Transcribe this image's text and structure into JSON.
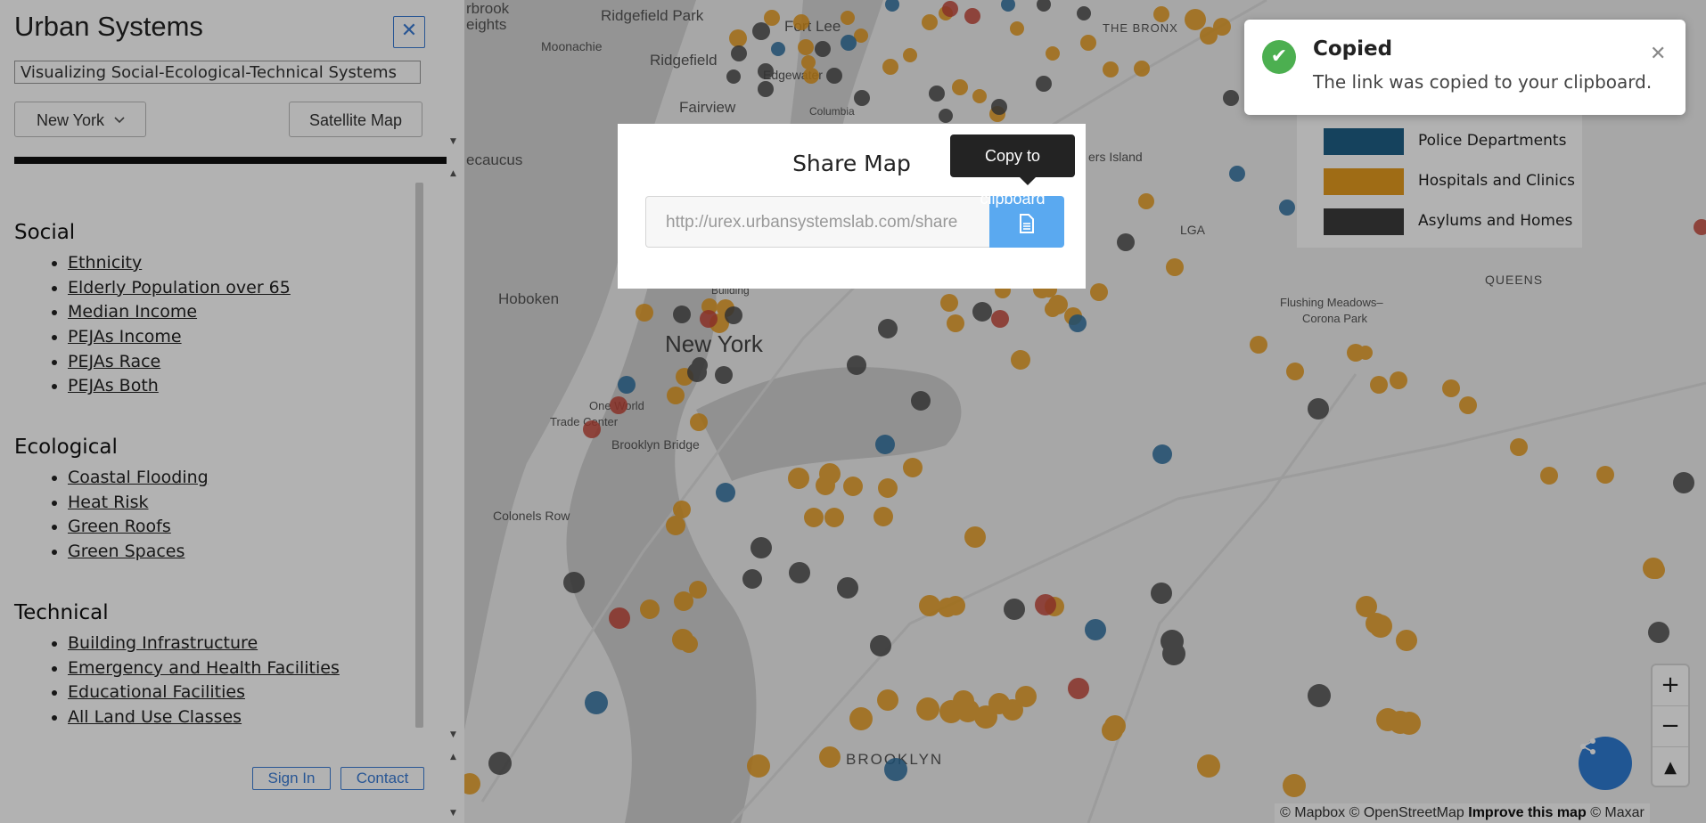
{
  "sidebar": {
    "title": "Urban Systems",
    "subtitle": "Visualizing Social-Ecological-Technical Systems",
    "city_select": "New York",
    "satellite_button": "Satellite Map",
    "sections": [
      {
        "heading": "Social",
        "items": [
          "Ethnicity",
          "Elderly Population over 65",
          "Median Income",
          "PEJAs Income",
          "PEJAs Race",
          "PEJAs Both"
        ]
      },
      {
        "heading": "Ecological",
        "items": [
          "Coastal Flooding",
          "Heat Risk",
          "Green Roofs",
          "Green Spaces"
        ]
      },
      {
        "heading": "Technical",
        "items": [
          "Building Infrastructure",
          "Emergency and Health Facilities",
          "Educational Facilities",
          "All Land Use Classes"
        ]
      }
    ],
    "signin_label": "Sign In",
    "contact_label": "Contact",
    "close_symbol": "✕"
  },
  "map": {
    "labels": [
      "Ridgefield Park",
      "Fort Lee",
      "THE BRONX",
      "Moonachie",
      "Ridgefield",
      "Edgewater",
      "Fairview",
      "Columbia",
      "ecaucus",
      "ers Island",
      "LGA",
      "Hoboken",
      "Building",
      "New York",
      "QUEENS",
      "Flushing Meadows–",
      "Corona Park",
      "One World",
      "Trade Center",
      "Brooklyn Bridge",
      "Colonels Row",
      "BROOKLYN",
      "eights",
      "rbrook"
    ],
    "legend": [
      {
        "label": "Police Departments",
        "color": "#1f5f86"
      },
      {
        "label": "Hospitals and Clinics",
        "color": "#e49b1f"
      },
      {
        "label": "Asylums and Homes",
        "color": "#3c3c3c"
      }
    ],
    "point_colors": {
      "police": "#2c6f9f",
      "hospital": "#e79b1d",
      "asylum": "#4a4a4a",
      "fire": "#c4473a"
    },
    "attribution": {
      "mapbox": "© Mapbox",
      "osm": "© OpenStreetMap",
      "improve": "Improve this map",
      "maxar": "© Maxar"
    },
    "zoom_in": "+",
    "zoom_out": "−",
    "compass": "▲"
  },
  "modal": {
    "title": "Share Map",
    "url_value": "http://urex.urbansystemslab.com/share",
    "copy_icon": "document-icon",
    "tooltip": "Copy to clipboard"
  },
  "toast": {
    "title": "Copied",
    "message": "The link was copied to your clipboard.",
    "close_symbol": "✕",
    "check_symbol": "✔"
  }
}
